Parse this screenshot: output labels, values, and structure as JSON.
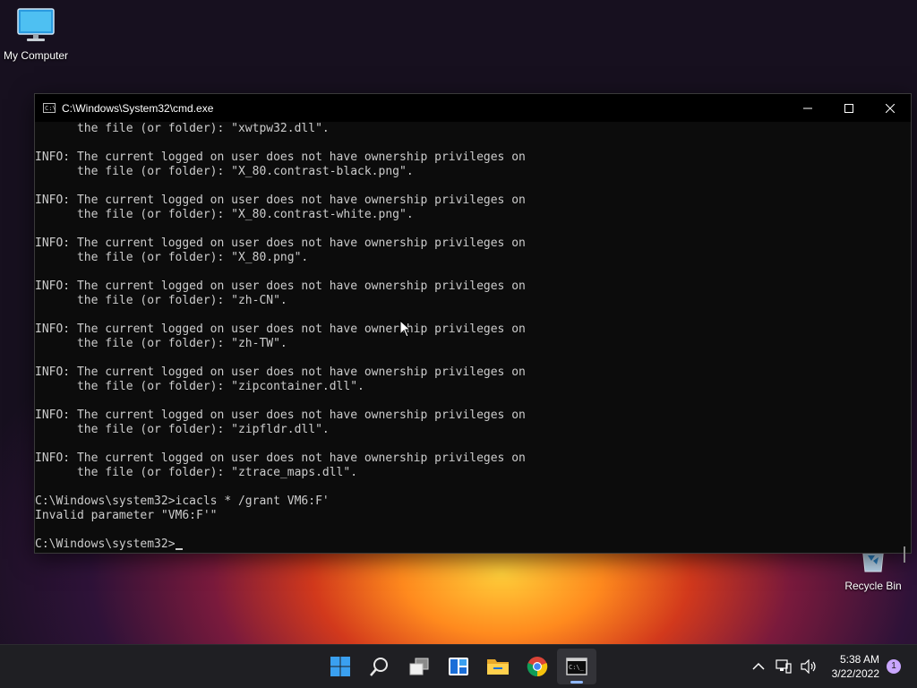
{
  "desktop": {
    "icons": [
      {
        "label": "My Computer"
      },
      {
        "label": "Recycle Bin"
      }
    ]
  },
  "cmd_window": {
    "title": "C:\\Windows\\System32\\cmd.exe",
    "app_icon_text": "C:\\",
    "lines": [
      "      the file (or folder): \"xwtpw32.dll\".",
      "",
      "INFO: The current logged on user does not have ownership privileges on",
      "      the file (or folder): \"X_80.contrast-black.png\".",
      "",
      "INFO: The current logged on user does not have ownership privileges on",
      "      the file (or folder): \"X_80.contrast-white.png\".",
      "",
      "INFO: The current logged on user does not have ownership privileges on",
      "      the file (or folder): \"X_80.png\".",
      "",
      "INFO: The current logged on user does not have ownership privileges on",
      "      the file (or folder): \"zh-CN\".",
      "",
      "INFO: The current logged on user does not have ownership privileges on",
      "      the file (or folder): \"zh-TW\".",
      "",
      "INFO: The current logged on user does not have ownership privileges on",
      "      the file (or folder): \"zipcontainer.dll\".",
      "",
      "INFO: The current logged on user does not have ownership privileges on",
      "      the file (or folder): \"zipfldr.dll\".",
      "",
      "INFO: The current logged on user does not have ownership privileges on",
      "      the file (or folder): \"ztrace_maps.dll\".",
      "",
      "C:\\Windows\\system32>icacls * /grant VM6:F'",
      "Invalid parameter \"VM6:F'\"",
      ""
    ],
    "prompt": "C:\\Windows\\system32>"
  },
  "taskbar": {
    "apps": [
      {
        "name": "Start",
        "icon": "windows-start-icon"
      },
      {
        "name": "Search",
        "icon": "search-icon"
      },
      {
        "name": "Task View",
        "icon": "task-view-icon"
      },
      {
        "name": "Widgets",
        "icon": "widgets-icon"
      },
      {
        "name": "File Explorer",
        "icon": "folder-icon"
      },
      {
        "name": "Chrome",
        "icon": "chrome-icon"
      },
      {
        "name": "Command Prompt",
        "icon": "terminal-icon"
      }
    ],
    "clock": {
      "time": "5:38 AM",
      "date": "3/22/2022"
    },
    "notification_count": "1"
  },
  "colors": {
    "taskbar_bg": "#1f1f23",
    "console_bg": "#0c0c0c",
    "console_fg": "#cccccc",
    "accent": "#8fb8ff"
  }
}
